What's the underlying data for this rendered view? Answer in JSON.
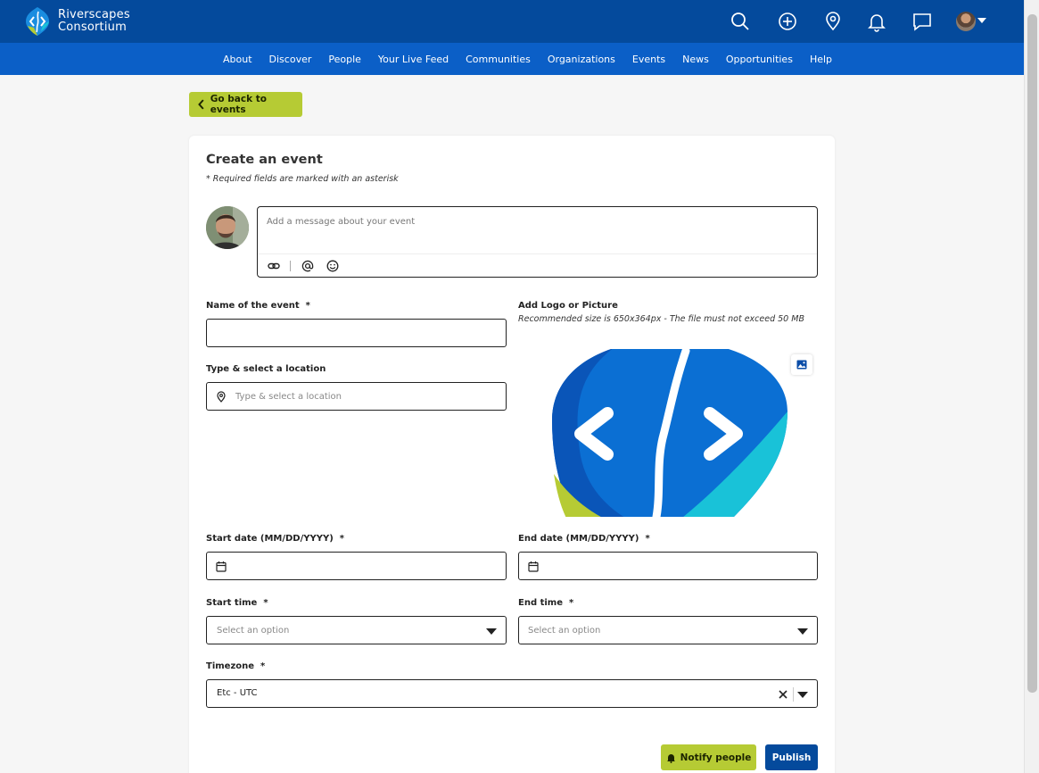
{
  "brand": {
    "name_line1": "Riverscapes",
    "name_line2": "Consortium"
  },
  "top_icons": [
    "search-icon",
    "plus-circle-icon",
    "map-pin-icon",
    "bell-icon",
    "chat-icon",
    "avatar-menu"
  ],
  "nav": {
    "items": [
      {
        "label": "About"
      },
      {
        "label": "Discover"
      },
      {
        "label": "People"
      },
      {
        "label": "Your Live Feed"
      },
      {
        "label": "Communities"
      },
      {
        "label": "Organizations"
      },
      {
        "label": "Events"
      },
      {
        "label": "News"
      },
      {
        "label": "Opportunities"
      },
      {
        "label": "Help"
      }
    ]
  },
  "back_button": {
    "label": "Go back to events"
  },
  "form": {
    "title": "Create an event",
    "required_note": "* Required fields are marked with an asterisk",
    "message": {
      "placeholder": "Add a message about your event"
    },
    "name_label": "Name of the event",
    "name_value": "",
    "location_label": "Type & select a location",
    "location_placeholder": "Type & select a location",
    "logo_label": "Add Logo or Picture",
    "logo_hint": "Recommended size is 650x364px - The file must not exceed 50 MB",
    "start_date_label": "Start date (MM/DD/YYYY)",
    "end_date_label": "End date (MM/DD/YYYY)",
    "start_time_label": "Start time",
    "start_time_placeholder": "Select an option",
    "end_time_label": "End time",
    "end_time_placeholder": "Select an option",
    "timezone_label": "Timezone",
    "timezone_value": "Etc - UTC",
    "asterisk": "*"
  },
  "actions": {
    "notify_label": "Notify people",
    "publish_label": "Publish"
  },
  "colors": {
    "header_bg": "#044a9c",
    "nav_bg": "#0b5fc7",
    "accent_green": "#b6cb34",
    "primary_blue": "#044a9c"
  }
}
